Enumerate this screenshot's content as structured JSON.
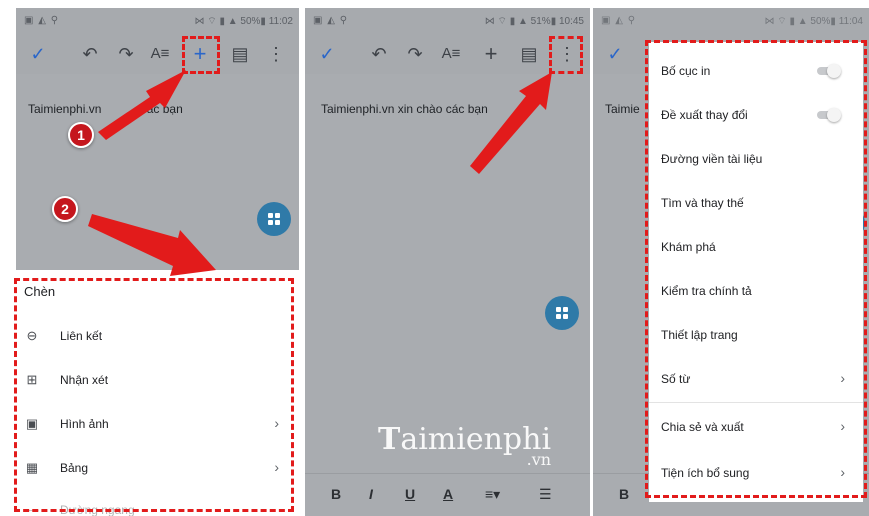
{
  "panel1": {
    "status_right": "11:02",
    "status_battery": "50%",
    "doc_text_a": "Taimienphi.vn ",
    "doc_text_b": "các bạn",
    "sheet_title": "Chèn",
    "sheet_items": [
      {
        "label": "Liên kết",
        "icon": "link-icon"
      },
      {
        "label": "Nhận xét",
        "icon": "add-comment-icon"
      },
      {
        "label": "Hình ảnh",
        "icon": "image-icon",
        "has_submenu": true
      },
      {
        "label": "Bảng",
        "icon": "table-icon",
        "has_submenu": true
      },
      {
        "label": "Đường ngang",
        "icon": "horizontal-line-icon"
      }
    ]
  },
  "panel2": {
    "status_right": "10:45",
    "status_battery": "51%",
    "doc_text": "Taimienphi.vn xin chào các bạn"
  },
  "panel3": {
    "status_right": "11:04",
    "status_battery": "50%",
    "doc_text": "Taimie",
    "menu_items": [
      {
        "label": "Bố cục in",
        "control": "toggle"
      },
      {
        "label": "Đề xuất thay đổi",
        "control": "toggle"
      },
      {
        "label": "Đường viền tài liệu"
      },
      {
        "label": "Tìm và thay thế"
      },
      {
        "label": "Khám phá"
      },
      {
        "label": "Kiểm tra chính tả"
      },
      {
        "label": "Thiết lập trang"
      },
      {
        "label": "Số từ",
        "has_submenu": true
      },
      {
        "label": "Chia sẻ và xuất",
        "has_submenu": true
      },
      {
        "label": "Tiện ích bổ sung",
        "has_submenu": true
      }
    ]
  },
  "badges": {
    "one": "1",
    "two": "2"
  },
  "watermark": {
    "main": "aimienphi",
    "prefix": "T",
    "suffix": ".vn"
  },
  "colors": {
    "accent": "#2a66c9",
    "highlight": "#e21b1b",
    "fab": "#2f7aa8"
  }
}
